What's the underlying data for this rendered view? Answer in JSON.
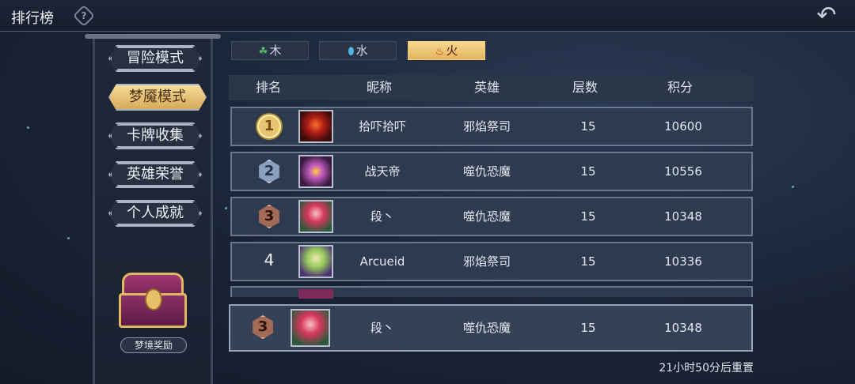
{
  "header": {
    "title": "排行榜",
    "help_icon": "?"
  },
  "menu": {
    "items": [
      {
        "label": "冒险模式",
        "active": false
      },
      {
        "label": "梦魇模式",
        "active": true
      },
      {
        "label": "卡牌收集",
        "active": false
      },
      {
        "label": "英雄荣誉",
        "active": false
      },
      {
        "label": "个人成就",
        "active": false
      }
    ]
  },
  "reward": {
    "label": "梦境奖励"
  },
  "tabs": [
    {
      "label": "木",
      "icon": "leaf-icon",
      "active": false
    },
    {
      "label": "水",
      "icon": "water-drop-icon",
      "active": false
    },
    {
      "label": "火",
      "icon": "fire-icon",
      "active": true
    }
  ],
  "table": {
    "headers": [
      "排名",
      "昵称",
      "英雄",
      "层数",
      "积分"
    ],
    "rows": [
      {
        "rank": "1",
        "name": "拾吓拾吓",
        "hero": "邪焰祭司",
        "floor": "15",
        "score": "10600"
      },
      {
        "rank": "2",
        "name": "战天帝",
        "hero": "噬仇恐魔",
        "floor": "15",
        "score": "10556"
      },
      {
        "rank": "3",
        "name": "段丶",
        "hero": "噬仇恐魔",
        "floor": "15",
        "score": "10348"
      },
      {
        "rank": "4",
        "name": "Arcueid",
        "hero": "邪焰祭司",
        "floor": "15",
        "score": "10336"
      }
    ],
    "my_row": {
      "rank": "3",
      "name": "段丶",
      "hero": "噬仇恐魔",
      "floor": "15",
      "score": "10348"
    }
  },
  "reset_text": "21小时50分后重置"
}
